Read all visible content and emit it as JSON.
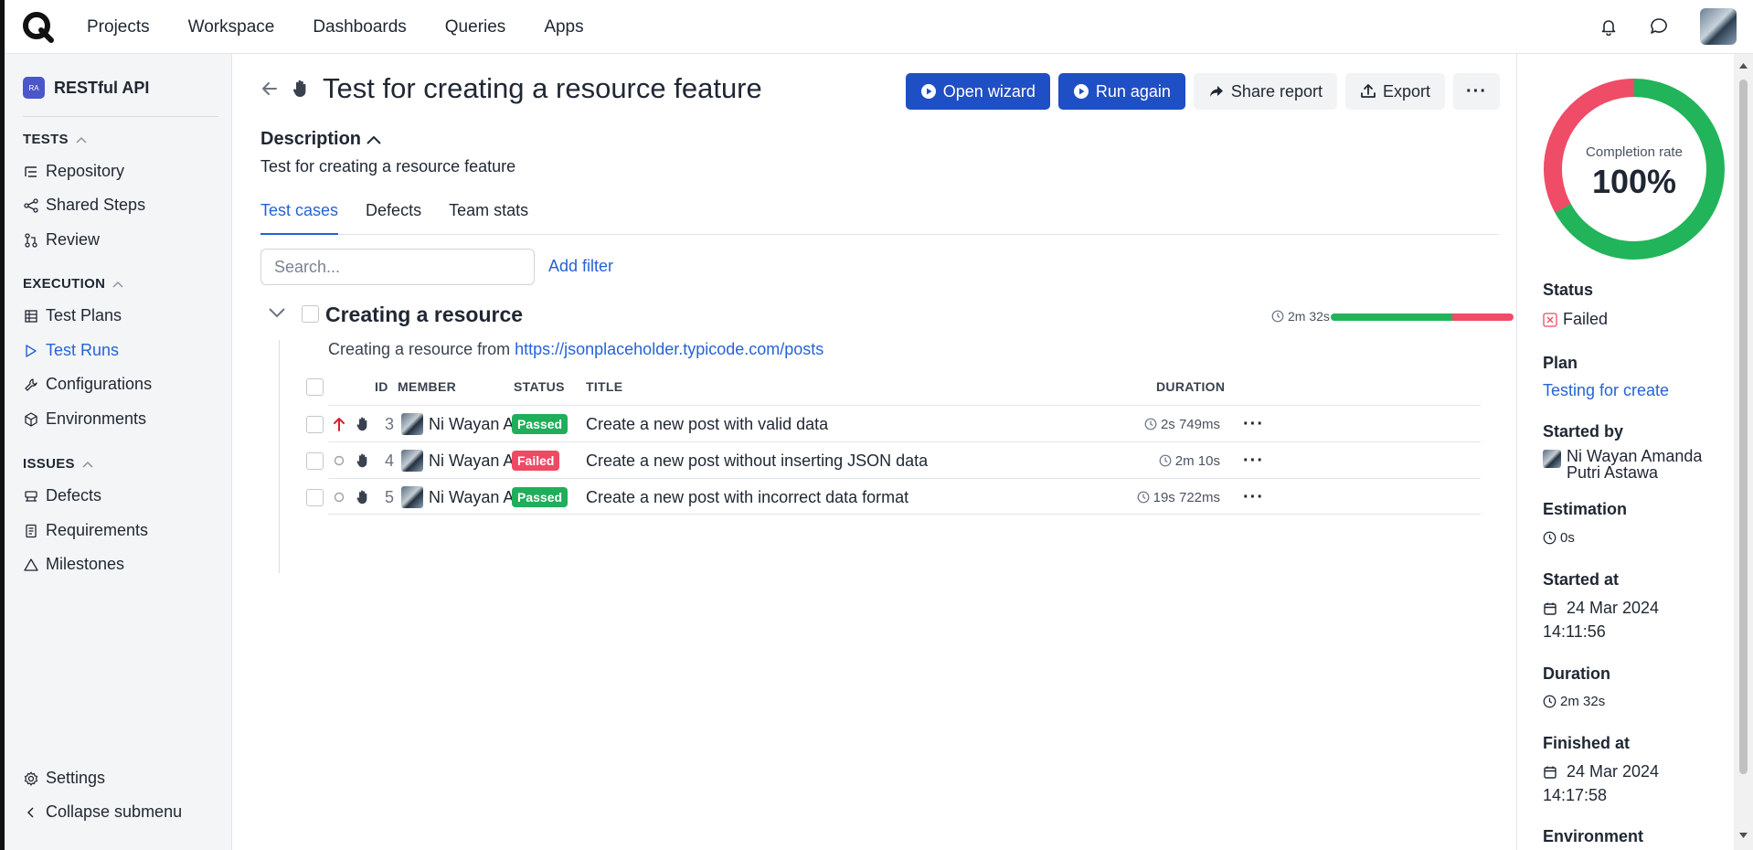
{
  "topbar": {
    "nav": [
      "Projects",
      "Workspace",
      "Dashboards",
      "Queries",
      "Apps"
    ]
  },
  "sidebar": {
    "project_badge": "RA",
    "project_name": "RESTful API",
    "sections": {
      "tests": "TESTS",
      "execution": "EXECUTION",
      "issues": "ISSUES"
    },
    "items": {
      "repository": "Repository",
      "shared_steps": "Shared Steps",
      "review": "Review",
      "test_plans": "Test Plans",
      "test_runs": "Test Runs",
      "configurations": "Configurations",
      "environments": "Environments",
      "defects": "Defects",
      "requirements": "Requirements",
      "milestones": "Milestones"
    },
    "settings": "Settings",
    "collapse": "Collapse submenu"
  },
  "header": {
    "title": "Test for creating a resource feature",
    "actions": {
      "open_wizard": "Open wizard",
      "run_again": "Run again",
      "share_report": "Share report",
      "export": "Export"
    }
  },
  "description": {
    "heading": "Description",
    "text": "Test for creating a resource feature"
  },
  "tabs": [
    "Test cases",
    "Defects",
    "Team stats"
  ],
  "search": {
    "placeholder": "Search..."
  },
  "add_filter": "Add filter",
  "suite": {
    "title": "Creating a resource",
    "duration": "2m 32s",
    "passed_fraction": 0.667,
    "failed_fraction": 0.333,
    "desc_prefix": "Creating a resource from ",
    "desc_link": "https://jsonplaceholder.typicode.com/posts"
  },
  "table": {
    "headers": {
      "id": "ID",
      "member": "MEMBER",
      "status": "STATUS",
      "title": "TITLE",
      "duration": "DURATION"
    },
    "rows": [
      {
        "id": "3",
        "member": "Ni Wayan Am",
        "status": "Passed",
        "title": "Create a new post with valid data",
        "duration": "2s 749ms"
      },
      {
        "id": "4",
        "member": "Ni Wayan Am",
        "status": "Failed",
        "title": "Create a new post without inserting JSON data",
        "duration": "2m 10s"
      },
      {
        "id": "5",
        "member": "Ni Wayan Am",
        "status": "Passed",
        "title": "Create a new post with incorrect data format",
        "duration": "19s 722ms"
      }
    ]
  },
  "panel": {
    "completion_label": "Completion rate",
    "completion_value": "100%",
    "completion_passed_fraction": 0.67,
    "completion_failed_fraction": 0.33,
    "status_label": "Status",
    "status_value": "Failed",
    "plan_label": "Plan",
    "plan_value": "Testing for create",
    "started_by_label": "Started by",
    "started_by_value": "Ni Wayan Amanda Putri Astawa",
    "estimation_label": "Estimation",
    "estimation_value": "0s",
    "started_at_label": "Started at",
    "started_at_date": "24 Mar 2024",
    "started_at_time": "14:11:56",
    "duration_label": "Duration",
    "duration_value": "2m 32s",
    "finished_at_label": "Finished at",
    "finished_at_date": "24 Mar 2024",
    "finished_at_time": "14:17:58",
    "environment_label": "Environment"
  },
  "colors": {
    "primary": "#1f4fc4",
    "link": "#2563d6",
    "passed": "#22b45a",
    "failed": "#ef4c68"
  }
}
